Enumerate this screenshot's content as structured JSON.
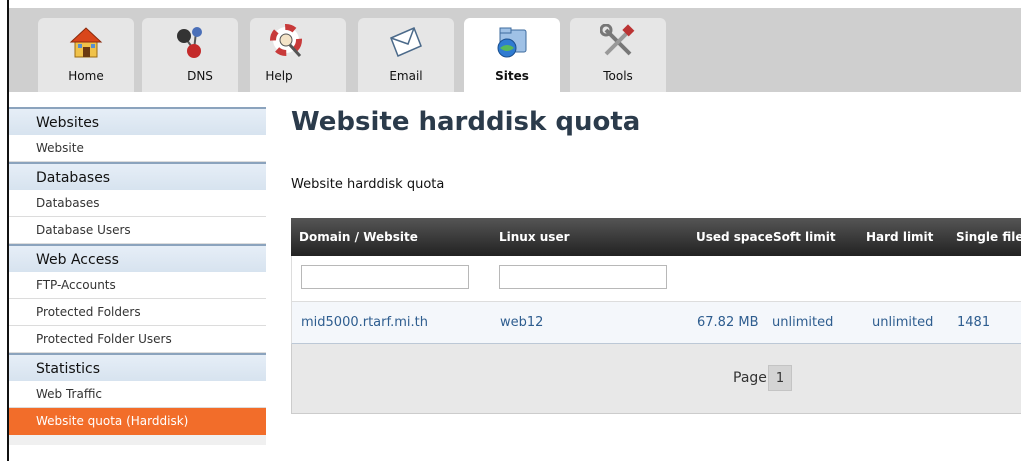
{
  "topnav": {
    "tabs": [
      {
        "label": "Home",
        "icon": "home-icon"
      },
      {
        "label": "DNS",
        "icon": "dns-network-icon"
      },
      {
        "label": "Help",
        "icon": "lifebuoy-icon"
      },
      {
        "label": "Email",
        "icon": "envelope-icon"
      },
      {
        "label": "Sites",
        "icon": "sites-folder-icon",
        "active": true
      },
      {
        "label": "Tools",
        "icon": "tools-icon"
      }
    ]
  },
  "sidebar": {
    "groups": [
      {
        "title": "Websites",
        "items": [
          "Website"
        ]
      },
      {
        "title": "Databases",
        "items": [
          "Databases",
          "Database Users"
        ]
      },
      {
        "title": "Web Access",
        "items": [
          "FTP-Accounts",
          "Protected Folders",
          "Protected Folder Users"
        ]
      },
      {
        "title": "Statistics",
        "items": [
          "Web Traffic",
          "Website quota (Harddisk)"
        ]
      }
    ],
    "active_item": "Website quota (Harddisk)"
  },
  "main": {
    "title": "Website harddisk quota",
    "section_title": "Website harddisk quota",
    "table": {
      "columns": [
        "Domain / Website",
        "Linux user",
        "Used space",
        "Soft limit",
        "Hard limit",
        "Single files"
      ],
      "filters": {
        "domain": "",
        "linux_user": ""
      },
      "rows": [
        {
          "domain": "mid5000.rtarf.mi.th",
          "linux_user": "web12",
          "used_space": "67.82 MB",
          "soft_limit": "unlimited",
          "hard_limit": "unlimited",
          "single_files": "1481"
        }
      ]
    },
    "pager": {
      "label": "Page",
      "current": "1"
    }
  },
  "colors": {
    "active_item": "#f26d2a",
    "header_dark": "#333333",
    "link": "#2e5d8f",
    "sidebar_head": "#dce7f2"
  }
}
